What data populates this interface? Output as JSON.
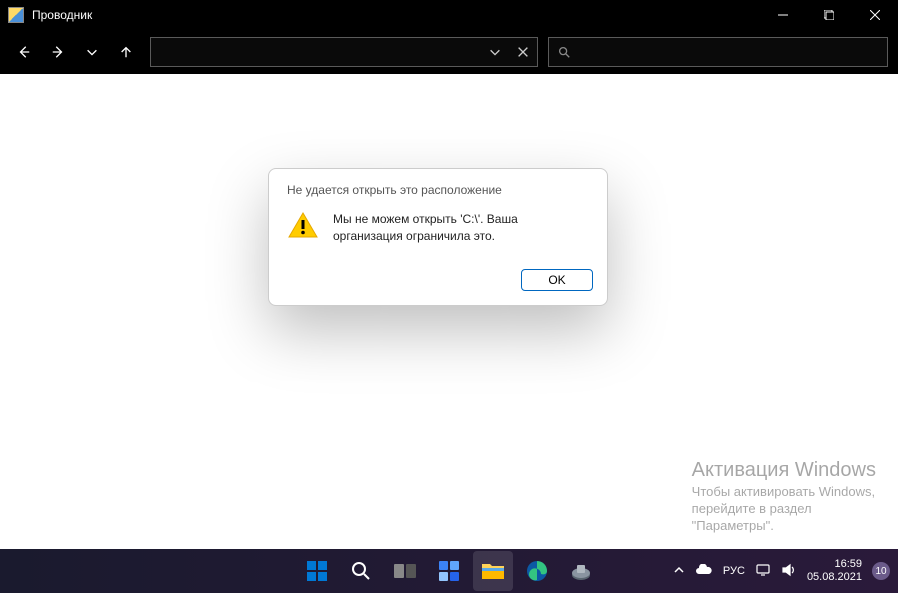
{
  "titlebar": {
    "title": "Проводник"
  },
  "dialog": {
    "title": "Не удается открыть это расположение",
    "message": "Мы не можем открыть 'C:\\'. Ваша организация ограничила это.",
    "ok": "OK"
  },
  "watermark": {
    "title": "Активация Windows",
    "line1": "Чтобы активировать Windows,",
    "line2": "перейдите в раздел",
    "line3": "\"Параметры\"."
  },
  "tray": {
    "lang": "РУС",
    "time": "16:59",
    "date": "05.08.2021",
    "badge": "10"
  }
}
